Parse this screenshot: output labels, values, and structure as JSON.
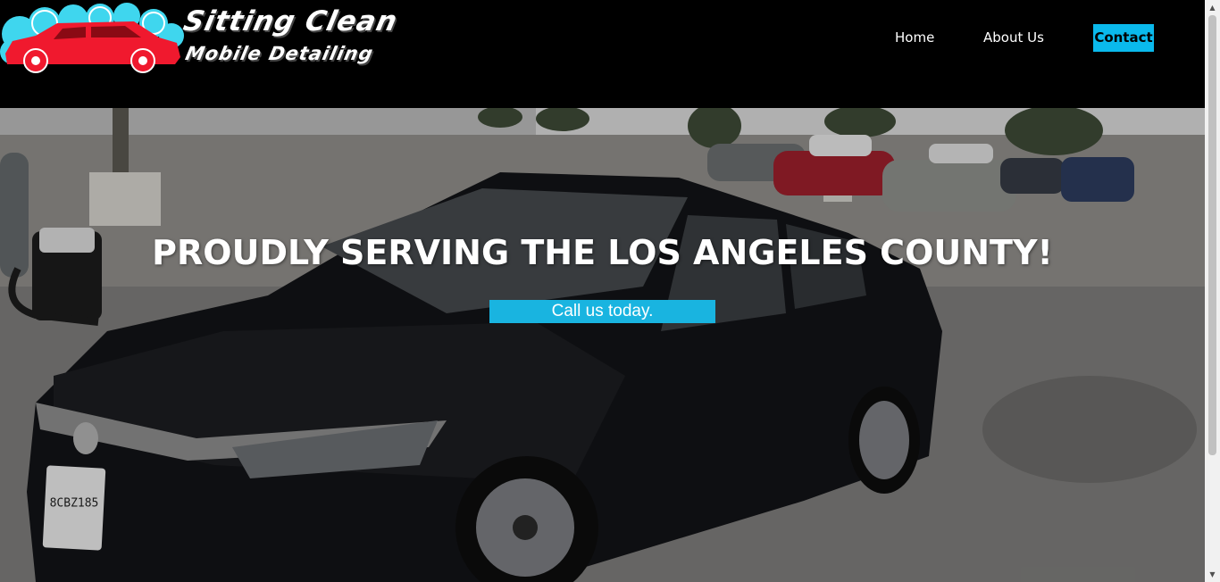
{
  "brand": {
    "line1": "Sitting Clean",
    "line2": "Mobile Detailing",
    "logo_icon": "car-bubbles-icon",
    "colors": {
      "car": "#f0192e",
      "bubbles": "#3fd6ee",
      "text": "#ffffff"
    }
  },
  "nav": {
    "items": [
      {
        "label": "Home"
      },
      {
        "label": "About Us"
      },
      {
        "label": "Contact"
      }
    ],
    "active_color": "#0ab9ec"
  },
  "hero": {
    "title": "PROUDLY SERVING THE LOS ANGELES COUNTY!",
    "cta_label": "Call us today.",
    "plate": "8CBZ185",
    "cta_color": "#19b4e0"
  }
}
